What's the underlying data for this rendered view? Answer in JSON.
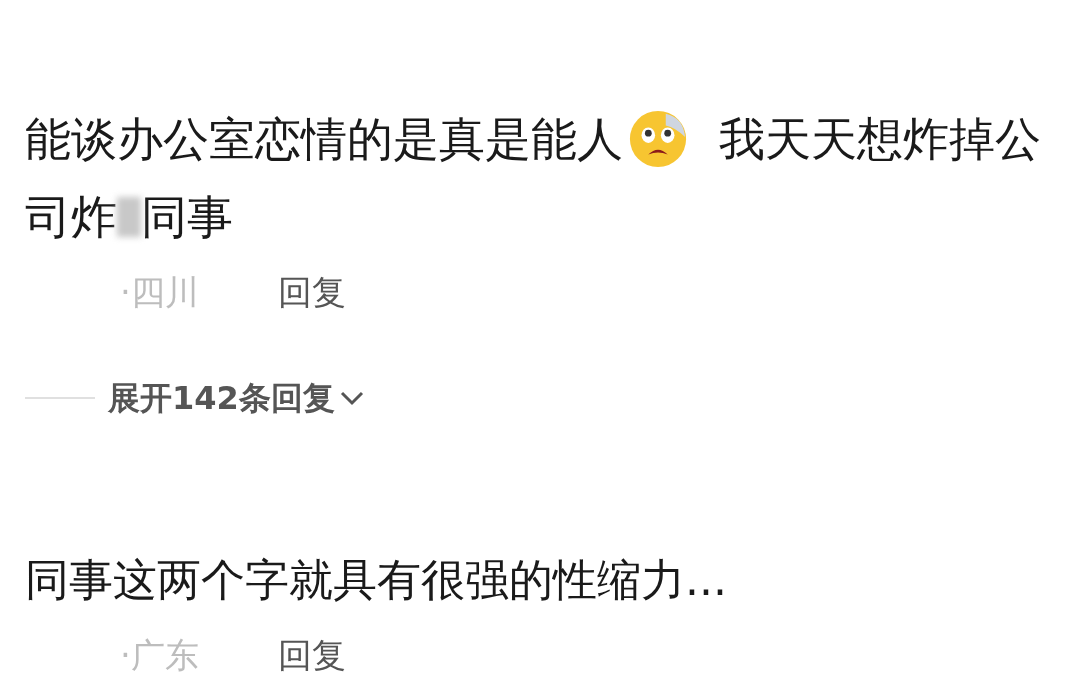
{
  "comments": [
    {
      "lines": [
        [
          {
            "kind": "text",
            "text": "能谈办公室恋情的是真是能人"
          },
          {
            "kind": "emoji"
          },
          {
            "kind": "text",
            "text": "我天天想炸掉公"
          }
        ],
        [
          {
            "kind": "text",
            "text": "司炸"
          },
          {
            "kind": "blur"
          },
          {
            "kind": "text",
            "text": "同事"
          }
        ]
      ],
      "location": "·四川",
      "reply": "回复",
      "expand": "展开142条回复"
    },
    {
      "lines": [
        [
          {
            "kind": "text",
            "text": "同事这两个字就具有很强的性缩力..."
          }
        ]
      ],
      "location": "·广东",
      "reply": "回复"
    }
  ]
}
